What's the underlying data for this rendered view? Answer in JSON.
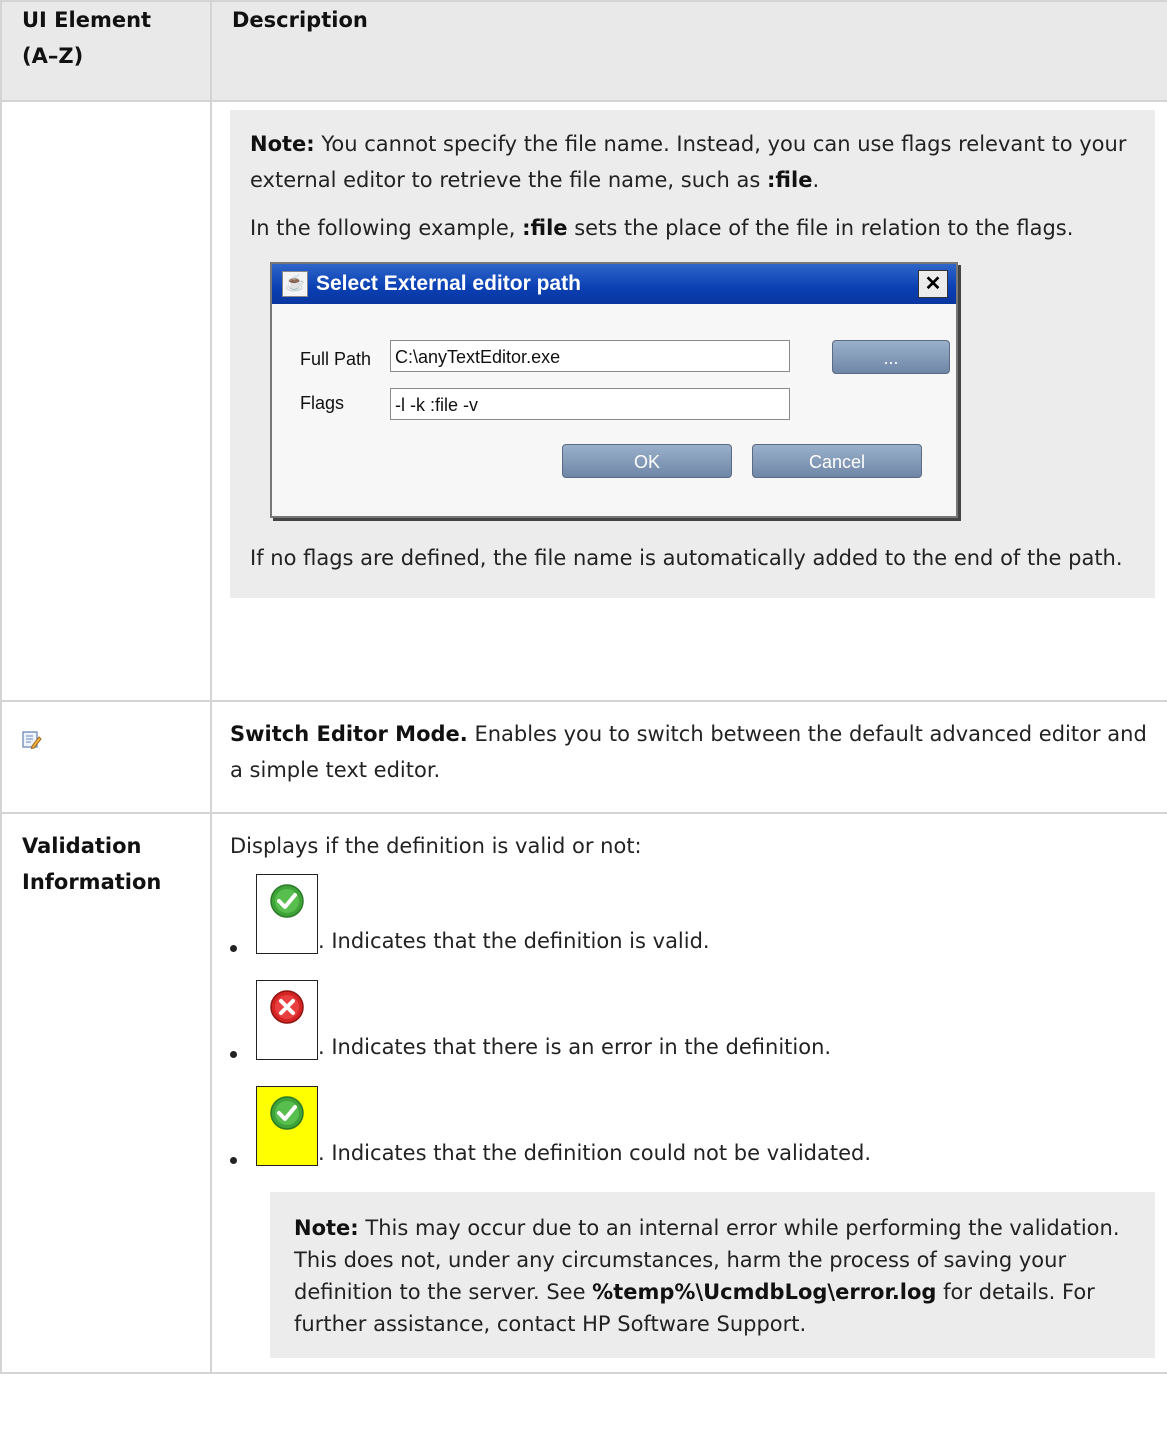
{
  "header": {
    "col1": "UI Element (A–Z)",
    "col2": "Description"
  },
  "row1": {
    "note_label": "Note:",
    "note_text_a": " You cannot specify the file name. Instead, you can use flags relevant to your external editor to retrieve the file name, such as ",
    "note_flag": ":file",
    "note_text_b": ".",
    "example_a": "In the following example, ",
    "example_flag": ":file",
    "example_b": " sets the place of the file in relation to the flags.",
    "dialog": {
      "title": "Select External editor path",
      "full_path_label": "Full Path",
      "full_path_value": "C:\\anyTextEditor.exe",
      "browse_label": "...",
      "flags_label": "Flags",
      "flags_value": "-l -k :file -v",
      "ok_label": "OK",
      "cancel_label": "Cancel"
    },
    "after_text": "If no flags are defined, the file name is automatically added to the end of the path."
  },
  "row2": {
    "icon": "edit-mode-icon",
    "bold": "Switch Editor Mode.",
    "text": " Enables you to switch between the default advanced editor and a simple text editor."
  },
  "row3": {
    "element": "Validation Information",
    "intro": "Displays if the definition is valid or not:",
    "items": [
      {
        "icon": "valid-check-icon",
        "text": ". Indicates that the definition is valid."
      },
      {
        "icon": "error-x-icon",
        "text": ". Indicates that there is an error in the definition."
      },
      {
        "icon": "not-validated-icon",
        "text": ". Indicates that the definition could not be validated."
      }
    ],
    "note_label": "Note:",
    "note_text_a": " This may occur due to an internal error while performing the validation. This does not, under any circumstances, harm the process of saving your definition to the server. See ",
    "note_path": "%temp%\\UcmdbLog\\error.log",
    "note_text_b": " for details. For further assistance, contact HP Software Support."
  },
  "colors": {
    "header_bg": "#e9e9e9",
    "note_bg": "#ececec",
    "border": "#d4d4d4",
    "valid_green": "#3fa33a",
    "error_red": "#d42424",
    "unvalidated_bg": "#ffff00"
  }
}
